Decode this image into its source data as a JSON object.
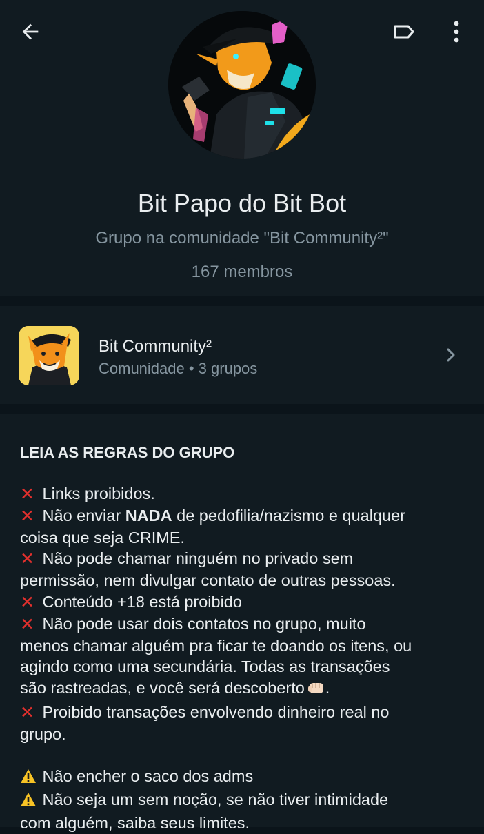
{
  "header": {
    "back_icon": "arrow-left-icon",
    "label_icon": "label-icon",
    "menu_icon": "more-vertical-icon"
  },
  "group": {
    "title": "Bit Papo do Bit Bot",
    "subtitle": "Grupo na comunidade \"Bit Community²\"",
    "members": "167 membros"
  },
  "community": {
    "name": "Bit Community²",
    "meta": "Comunidade • 3 grupos"
  },
  "description": {
    "heading": "LEIA AS REGRAS DO GRUPO",
    "rules": [
      {
        "pre": "Links proibidos."
      },
      {
        "pre": "Não enviar ",
        "bold": "NADA",
        "post": " de pedofilia/nazismo e qualquer"
      },
      {
        "cont": "coisa que seja CRIME."
      },
      {
        "pre": "Não pode chamar ninguém no privado sem"
      },
      {
        "cont": "permissão, nem divulgar contato de outras pessoas."
      },
      {
        "pre": "Conteúdo +18 está proibido"
      },
      {
        "pre": "Não pode usar dois contatos no grupo, muito"
      },
      {
        "cont": "menos chamar alguém pra ficar te doando os itens, ou"
      },
      {
        "cont": "agindo como uma secundária. Todas as transações"
      },
      {
        "cont": "são rastreadas, e você será descoberto"
      },
      {
        "pre": "Proibido transações envolvendo dinheiro real no"
      },
      {
        "cont": "grupo."
      }
    ],
    "warnings": [
      {
        "pre": "Não encher o saco dos adms"
      },
      {
        "pre": "Não seja um sem noção, se não tiver intimidade"
      },
      {
        "cont": "com alguém, saiba seus limites."
      }
    ]
  },
  "colors": {
    "background": "#0b141a",
    "panel": "#111b21",
    "text_primary": "#e9edef",
    "text_secondary": "#8696a0",
    "rule_red": "#e0302d",
    "warn_yellow": "#f7c325"
  }
}
